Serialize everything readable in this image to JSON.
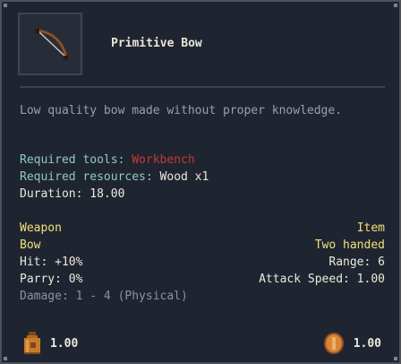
{
  "item": {
    "name": "Primitive Bow",
    "icon": "bow-icon",
    "description": "Low quality bow made without proper knowledge."
  },
  "crafting": {
    "tools_label": "Required tools:",
    "tools_value": "Workbench",
    "resources_label": "Required resources:",
    "resources_value": "Wood x1",
    "duration": "Duration: 18.00"
  },
  "stats": {
    "category_left": "Weapon",
    "category_right": "Item",
    "type_left": "Bow",
    "type_right": "Two handed",
    "hit": "Hit: +10%",
    "range": "Range: 6",
    "parry": "Parry: 0%",
    "attack_speed": "Attack Speed: 1.00",
    "damage": "Damage: 1 - 4 (Physical)"
  },
  "footer": {
    "weight_icon": "weight-jar-icon",
    "weight": "1.00",
    "value_icon": "coin-icon",
    "value": "1.00"
  },
  "colors": {
    "background": "#1f2530",
    "border": "#4a5262",
    "teal_label": "#8ecbbd",
    "red_value": "#c23a2e",
    "yellow_heading": "#f1e07a",
    "grey_text": "#8d939c"
  }
}
